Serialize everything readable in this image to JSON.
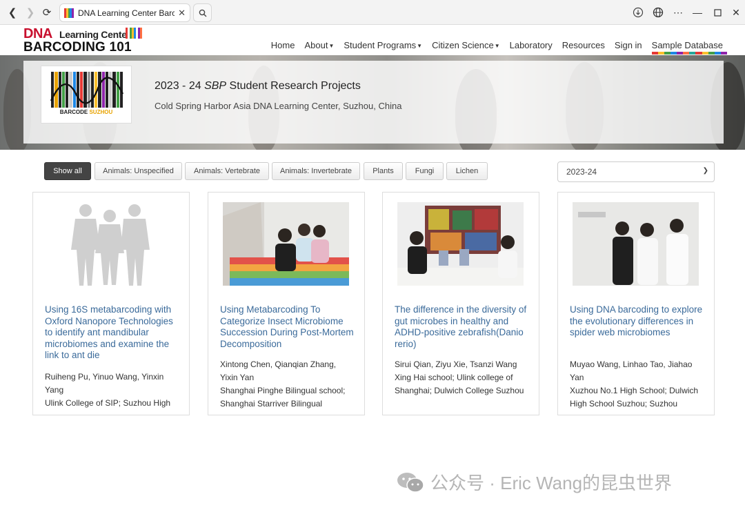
{
  "browser": {
    "tab_title": "DNA Learning Center Barco",
    "favicon_colors": [
      "#e53935",
      "#fbc02d",
      "#43a047",
      "#1e88e5",
      "#8e24aa"
    ]
  },
  "site": {
    "logo_top": "DNA",
    "logo_lc": "Learning Center",
    "logo_bottom": "BARCODING 101",
    "nav": [
      {
        "label": "Home"
      },
      {
        "label": "About"
      },
      {
        "label": "Student Programs"
      },
      {
        "label": "Citizen Science"
      },
      {
        "label": "Laboratory"
      },
      {
        "label": "Resources"
      },
      {
        "label": "Sign in"
      },
      {
        "label": "Sample Database"
      }
    ]
  },
  "hero": {
    "title_prefix": "2023 - 24",
    "title_italic": "SBP",
    "title_suffix": "Student Research Projects",
    "subtitle": "Cold Spring Harbor Asia DNA Learning Center, Suzhou, China",
    "logo_text_1": "BARCODE",
    "logo_text_2": "SUZHOU"
  },
  "filters": [
    {
      "label": "Show all",
      "active": true
    },
    {
      "label": "Animals: Unspecified"
    },
    {
      "label": "Animals: Vertebrate"
    },
    {
      "label": "Animals: Invertebrate"
    },
    {
      "label": "Plants"
    },
    {
      "label": "Fungi"
    },
    {
      "label": "Lichen"
    }
  ],
  "year_select": {
    "value": "2023-24"
  },
  "cards": [
    {
      "title": "Using 16S metabarcoding with Oxford Nanopore Technologies to identify ant mandibular microbiomes and examine the link to ant die",
      "authors": "Ruiheng Pu, Yinuo Wang, Yinxin Yang",
      "schools": "Ulink College of SIP; Suzhou High"
    },
    {
      "title": "Using Metabarcoding To Categorize Insect Microbiome Succession During Post-Mortem Decomposition",
      "authors": "Xintong Chen, Qianqian Zhang, Yixin Yan",
      "schools": "Shanghai Pinghe Bilingual school; Shanghai Starriver Bilingual"
    },
    {
      "title": "The difference in the diversity of gut microbes in healthy and ADHD-positive zebrafish(Danio rerio)",
      "authors": "Sirui Qian, Ziyu Xie, Tsanzi Wang",
      "schools": "Xing Hai school; Ulink college of Shanghai; Dulwich College Suzhou"
    },
    {
      "title": "Using DNA barcoding to explore the evolutionary differences in spider web microbiomes",
      "authors": "Muyao Wang, Linhao Tao, Jiahao Yan",
      "schools": "Xuzhou No.1 High School; Dulwich High School Suzhou; Suzhou"
    }
  ],
  "watermark": "公众号 · Eric Wang的昆虫世界"
}
